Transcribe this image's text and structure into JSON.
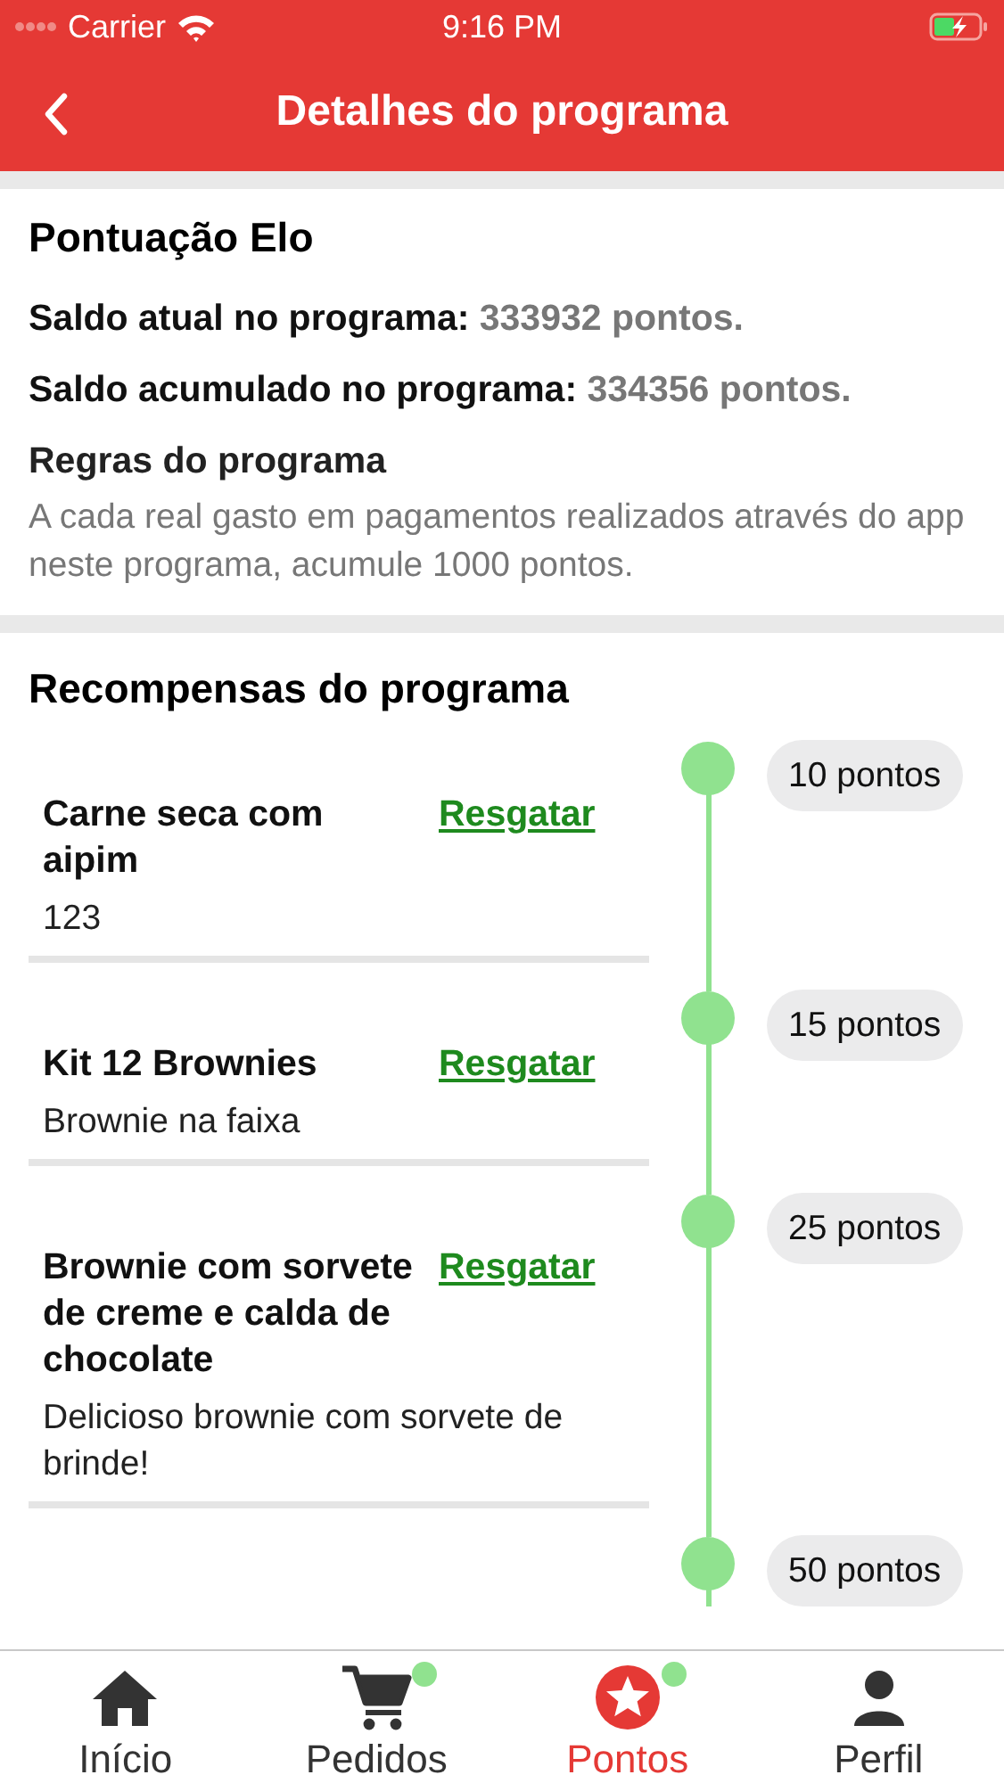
{
  "status_bar": {
    "carrier": "Carrier",
    "time": "9:16 PM"
  },
  "nav_bar": {
    "title": "Detalhes do programa"
  },
  "program": {
    "name": "Pontuação Elo",
    "balances": [
      {
        "label": "Saldo atual no programa:",
        "value": "333932 pontos."
      },
      {
        "label": "Saldo acumulado no programa:",
        "value": "334356 pontos."
      }
    ],
    "rules_title": "Regras do programa",
    "rules_text": "A cada real gasto em pagamentos realizados através do app neste programa, acumule 1000 pontos."
  },
  "rewards": {
    "title": "Recompensas do programa",
    "items": [
      {
        "title": "Carne seca com aipim",
        "action": "Resgatar",
        "description": "123",
        "points": "10 pontos"
      },
      {
        "title": "Kit 12 Brownies",
        "action": "Resgatar",
        "description": "Brownie na faixa",
        "points": "15 pontos"
      },
      {
        "title": "Brownie com sorvete de creme e calda de chocolate",
        "action": "Resgatar",
        "description": "Delicioso brownie com sorvete de brinde!",
        "points": "25 pontos"
      },
      {
        "points": "50 pontos"
      }
    ]
  },
  "tab_bar": [
    {
      "label": "Início",
      "kind": "home",
      "selected": false,
      "badge": false
    },
    {
      "label": "Pedidos",
      "kind": "cart",
      "selected": false,
      "badge": true
    },
    {
      "label": "Pontos",
      "kind": "star",
      "selected": true,
      "badge": true
    },
    {
      "label": "Perfil",
      "kind": "person",
      "selected": false,
      "badge": false
    }
  ]
}
